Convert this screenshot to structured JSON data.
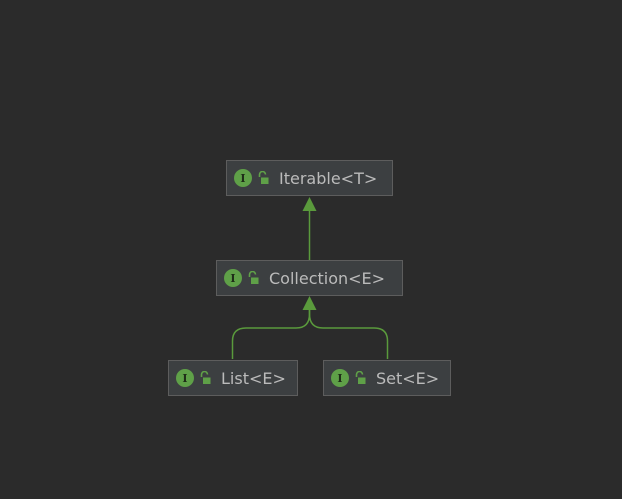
{
  "diagram": {
    "nodes": {
      "iterable": {
        "label": "Iterable<T>",
        "kind": "interface",
        "icon": "interface-icon",
        "access_icon": "public-access-icon"
      },
      "collection": {
        "label": "Collection<E>",
        "kind": "interface",
        "icon": "interface-icon",
        "access_icon": "public-access-icon"
      },
      "list": {
        "label": "List<E>",
        "kind": "interface",
        "icon": "interface-icon",
        "access_icon": "public-access-icon"
      },
      "set": {
        "label": "Set<E>",
        "kind": "interface",
        "icon": "interface-icon",
        "access_icon": "public-access-icon"
      }
    },
    "edges": [
      {
        "from": "collection",
        "to": "iterable",
        "type": "extends"
      },
      {
        "from": "list",
        "to": "collection",
        "type": "extends"
      },
      {
        "from": "set",
        "to": "collection",
        "type": "extends"
      }
    ],
    "icon_letter": "I",
    "colors": {
      "background": "#2b2b2b",
      "node_fill": "#3c3f41",
      "node_border": "#5d5d5d",
      "node_text": "#bbbbbb",
      "interface_icon": "#5fa048",
      "edge": "#5a9a3c"
    }
  }
}
